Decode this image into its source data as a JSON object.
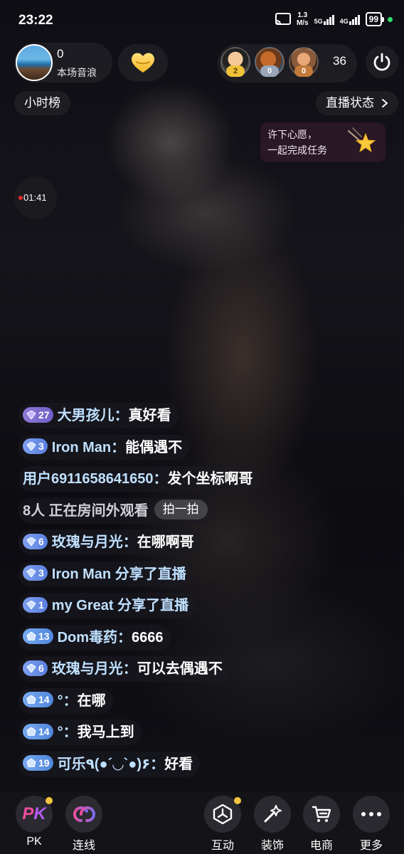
{
  "status_bar": {
    "time": "23:22",
    "speed_value": "1.3",
    "speed_unit": "M/s",
    "signal1": "5G",
    "signal2": "4G",
    "battery": "99"
  },
  "anchor": {
    "count": "0",
    "label": "本场音浪"
  },
  "viewers": {
    "badges": [
      "2",
      "0",
      "0"
    ],
    "count": "36"
  },
  "rank_label": "小时榜",
  "live_status_label": "直播状态",
  "wish": {
    "line1": "许下心愿，",
    "line2": "一起完成任务"
  },
  "timer": "01:41",
  "chat": {
    "messages": [
      {
        "level": "27",
        "name": "大男孩儿：",
        "text": "真好看"
      },
      {
        "level": "3",
        "name": "Iron Man：",
        "text": "能偶遇不"
      },
      {
        "name": "用户6911658641650：",
        "text": "发个坐标啊哥"
      },
      {
        "text": "8人 正在房间外观看",
        "button": "拍一拍"
      },
      {
        "level": "6",
        "name": "玫瑰与月光：",
        "text": "在哪啊哥"
      },
      {
        "level": "3",
        "name": "Iron Man",
        "text": " 分享了直播"
      },
      {
        "level": "1",
        "name": "my Great",
        "text": " 分享了直播"
      },
      {
        "level": "13",
        "name": "Dom毒药：",
        "text": "6666"
      },
      {
        "level": "6",
        "name": "玫瑰与月光：",
        "text": "可以去偶遇不"
      },
      {
        "level": "14",
        "name": "°：",
        "text": "在哪"
      },
      {
        "level": "14",
        "name": "°：",
        "text": "我马上到"
      },
      {
        "level": "19",
        "name": "可乐٩(●´◡`●)۶：",
        "text": "好看"
      }
    ]
  },
  "bottom_nav": {
    "pk": "PK",
    "connect": "连线",
    "interact": "互动",
    "decorate": "装饰",
    "ecommerce": "电商",
    "more": "更多"
  },
  "colors": {
    "name_blue": "#bfe0ff",
    "level_purple": "#7a68d0",
    "level_blue": "#5a7fe0",
    "pk_pink": "#f04ea0",
    "notif_yellow": "#f4c542"
  }
}
